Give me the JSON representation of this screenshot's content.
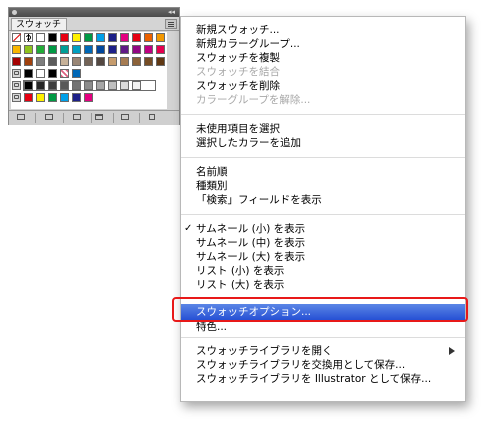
{
  "panel": {
    "tab_label": "スウォッチ",
    "swatch_rows": [
      [
        "none",
        "registration",
        "#ffffff",
        "#000000",
        "#e60012",
        "#fff100",
        "#009944",
        "#00a0e9",
        "#1d2088",
        "#e4007f",
        "#e60012",
        "#eb6100",
        "#f39800"
      ],
      [
        "#f8b500",
        "#8fc31f",
        "#22ac38",
        "#009944",
        "#009e96",
        "#00a0c1",
        "#0068b7",
        "#00479d",
        "#1d2088",
        "#601986",
        "#920783",
        "#be0081",
        "#e5004f"
      ],
      [
        "#a40000",
        "#a0410d",
        "#7d7d7d",
        "#5b5b5b",
        "#c7b299",
        "#998675",
        "#736357",
        "#534741",
        "#c69c6d",
        "#a67c52",
        "#8c6239",
        "#754c24",
        "#603813"
      ],
      [
        "group-icon",
        "#000000",
        "#ffffff",
        "#000000",
        "pattern",
        "#0068b7"
      ],
      [
        "group-icon",
        "#000000",
        "#262626",
        "#404040",
        "#595959",
        "#737373",
        "#8c8c8c",
        "#a6a6a6",
        "#bfbfbf",
        "#d9d9d9",
        "#f2f2f2"
      ],
      [
        "group-icon",
        "#e60012",
        "#fff100",
        "#009944",
        "#00a0e9",
        "#1d2088",
        "#e4007f"
      ]
    ],
    "bottom_buttons": [
      {
        "name": "swatch-library-menu-button",
        "glyph": "library"
      },
      {
        "name": "show-swatch-kinds-button",
        "glyph": "kinds"
      },
      {
        "name": "swatch-options-button",
        "glyph": "options"
      },
      {
        "name": "new-color-group-button",
        "glyph": "folder"
      },
      {
        "name": "new-swatch-button",
        "glyph": "new"
      },
      {
        "name": "delete-swatch-button",
        "glyph": "trash"
      }
    ]
  },
  "menu": {
    "items": [
      {
        "label": "新規スウォッチ...",
        "enabled": true
      },
      {
        "label": "新規カラーグループ...",
        "enabled": true
      },
      {
        "label": "スウォッチを複製",
        "enabled": true
      },
      {
        "label": "スウォッチを結合",
        "enabled": false
      },
      {
        "label": "スウォッチを削除",
        "enabled": true
      },
      {
        "label": "カラーグループを解除...",
        "enabled": false
      },
      {
        "label": "未使用項目を選択",
        "enabled": true
      },
      {
        "label": "選択したカラーを追加",
        "enabled": true
      },
      {
        "label": "名前順",
        "enabled": true
      },
      {
        "label": "種類別",
        "enabled": true
      },
      {
        "label": "「検索」フィールドを表示",
        "enabled": true
      },
      {
        "label": "サムネール (小) を表示",
        "enabled": true,
        "checked": true
      },
      {
        "label": "サムネール (中) を表示",
        "enabled": true
      },
      {
        "label": "サムネール (大) を表示",
        "enabled": true
      },
      {
        "label": "リスト (小) を表示",
        "enabled": true
      },
      {
        "label": "リスト (大) を表示",
        "enabled": true
      },
      {
        "label": "スウォッチオプション...",
        "enabled": true,
        "highlighted": true
      },
      {
        "label": "特色...",
        "enabled": true
      },
      {
        "label": "スウォッチライブラリを開く",
        "enabled": true,
        "submenu": true
      },
      {
        "label": "スウォッチライブラリを交換用として保存...",
        "enabled": true
      },
      {
        "label": "スウォッチライブラリを Illustrator として保存...",
        "enabled": true
      }
    ],
    "check_mark": "✓",
    "highlight_color": "#2650d4",
    "annotation_color": "#e81919"
  }
}
